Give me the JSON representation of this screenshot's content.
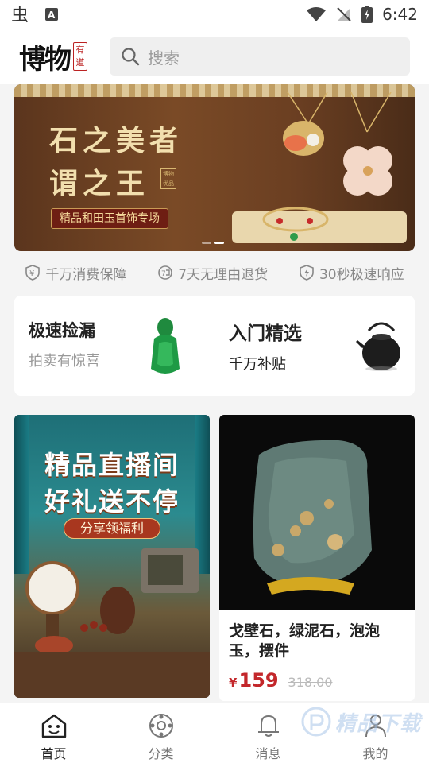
{
  "status_bar": {
    "time": "6:42"
  },
  "header": {
    "logo_text": "博物",
    "logo_seal": "有道",
    "search_placeholder": "搜索"
  },
  "banner": {
    "title_line1": "石之美者",
    "title_line2": "谓之王",
    "stamp": "博物优品",
    "subtitle": "精品和田玉首饰专场"
  },
  "guarantees": [
    {
      "label": "千万消费保障",
      "icon": "shield-yen-icon"
    },
    {
      "label": "7天无理由退货",
      "icon": "return-icon"
    },
    {
      "label": "30秒极速响应",
      "icon": "lightning-icon"
    }
  ],
  "feature_cards": [
    {
      "title": "极速捡漏",
      "subtitle": "拍卖有惊喜",
      "image": "jade-pendant"
    },
    {
      "title": "入门精选",
      "subtitle": "千万补贴",
      "image": "iron-teapot"
    }
  ],
  "live_banner": {
    "title_line1": "精品直播间",
    "title_line2": "好礼送不停",
    "subtitle": "分享领福利"
  },
  "product": {
    "name": "戈壁石，绿泥石，泡泡玉，摆件",
    "currency": "¥",
    "price": "159",
    "original_price": "318.00"
  },
  "tabbar": [
    {
      "label": "首页",
      "icon": "home-icon",
      "active": true
    },
    {
      "label": "分类",
      "icon": "category-icon",
      "active": false
    },
    {
      "label": "消息",
      "icon": "bell-icon",
      "active": false
    },
    {
      "label": "我的",
      "icon": "user-icon",
      "active": false
    }
  ],
  "watermark": {
    "text": "精品下载"
  },
  "colors": {
    "accent": "#c3272b",
    "banner_gold": "#f2dfae"
  }
}
